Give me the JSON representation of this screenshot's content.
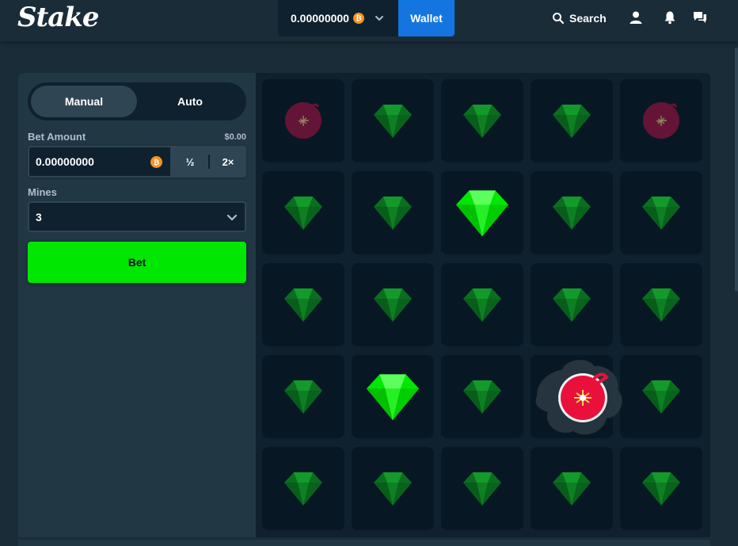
{
  "header": {
    "logo_text": "Stake",
    "balance": "0.00000000",
    "currency_icon": "bitcoin-icon",
    "wallet_label": "Wallet",
    "search_label": "Search",
    "icons": [
      "search-icon",
      "user-icon",
      "bell-icon",
      "chat-icon"
    ]
  },
  "sidebar": {
    "tabs": [
      {
        "label": "Manual",
        "active": true
      },
      {
        "label": "Auto",
        "active": false
      }
    ],
    "bet_amount": {
      "label": "Bet Amount",
      "usd_value": "$0.00",
      "value": "0.00000000",
      "half_label": "½",
      "double_label": "2×"
    },
    "mines": {
      "label": "Mines",
      "value": "3"
    },
    "bet_button_label": "Bet"
  },
  "grid": {
    "rows": 5,
    "cols": 5,
    "tiles": [
      [
        "bomb-dim",
        "gem-dim",
        "gem-dim",
        "gem-dim",
        "bomb-dim"
      ],
      [
        "gem-dim",
        "gem-dim",
        "gem-revealed",
        "gem-dim",
        "gem-dim"
      ],
      [
        "gem-dim",
        "gem-dim",
        "gem-dim",
        "gem-dim",
        "gem-dim"
      ],
      [
        "gem-dim",
        "gem-revealed",
        "gem-dim",
        "bomb-exploded",
        "gem-dim"
      ],
      [
        "gem-dim",
        "gem-dim",
        "gem-dim",
        "gem-dim",
        "gem-dim"
      ]
    ]
  },
  "colors": {
    "background": "#1a2c38",
    "panel": "#213743",
    "accent_green": "#00e701",
    "wallet_blue": "#1475e1",
    "gem_green": "#00e701",
    "bomb_red": "#e9113c"
  }
}
